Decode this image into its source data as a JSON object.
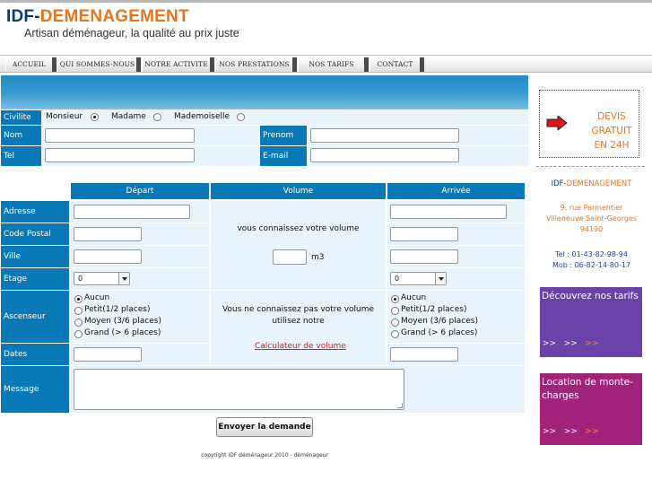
{
  "header": {
    "logo_part1": "IDF-",
    "logo_part2": "DEMENAGEMENT",
    "tagline": "Artisan déménageur, la qualité au prix juste"
  },
  "nav": [
    {
      "label": "ACCUEIL"
    },
    {
      "label": "QUI SOMMES-NOUS"
    },
    {
      "label": "NOTRE ACTIVITE"
    },
    {
      "label": "NOS PRESTATIONS"
    },
    {
      "label": "NOS TARIFS"
    },
    {
      "label": "CONTACT"
    }
  ],
  "form": {
    "civilite_label": "Civilite",
    "civilite_options": [
      {
        "label": "Monsieur",
        "selected": true
      },
      {
        "label": "Madame",
        "selected": false
      },
      {
        "label": "Mademoiselle",
        "selected": false
      }
    ],
    "nom_label": "Nom",
    "nom_value": "",
    "prenom_label": "Prenom",
    "prenom_value": "",
    "tel_label": "Tel",
    "tel_value": "",
    "email_label": "E-mail",
    "email_value": "",
    "col_depart": "Départ",
    "col_volume": "Volume",
    "col_arrivee": "Arrivée",
    "adresse_label": "Adresse",
    "cp_label": "Code Postal",
    "ville_label": "Ville",
    "etage_label": "Etage",
    "etage_depart_value": "0",
    "etage_arrivee_value": "0",
    "ascenseur_label": "Ascenseur",
    "ascenseur_depart": [
      {
        "label": "Aucun",
        "selected": true
      },
      {
        "label": "Petit(1/2 places)",
        "selected": false
      },
      {
        "label": "Moyen (3/6 places)",
        "selected": false
      },
      {
        "label": "Grand (> 6 places)",
        "selected": false
      }
    ],
    "ascenseur_arrivee": [
      {
        "label": "Aucun",
        "selected": true
      },
      {
        "label": "Petit(1/2 places)",
        "selected": false
      },
      {
        "label": "Moyen (3/6 places)",
        "selected": false
      },
      {
        "label": "Grand (> 6 places)",
        "selected": false
      }
    ],
    "dates_label": "Dates",
    "message_label": "Message",
    "message_value": "",
    "volume_known_text": "vous connaissez votre volume",
    "volume_value": "",
    "volume_unit": "m3",
    "volume_unknown_line1": "Vous ne connaissez pas votre volume",
    "volume_unknown_line2": "utilisez notre",
    "calc_link": "Calculateur de volume",
    "submit_label": "Envoyer la demande"
  },
  "footer": {
    "copyright": "copyright IDF déménageur 2010 - déménageur"
  },
  "sidebar": {
    "devis_line1": "DEVIS",
    "devis_line2": "GRATUIT",
    "devis_line3": "EN 24H",
    "company_part1": "IDF-",
    "company_part2": "DEMENAGEMENT",
    "address_line1": "9, rue Parmentier",
    "address_line2": "Villeneuve Saint-Georges",
    "address_line3": "94190",
    "tel": "Tel : 01-43-82-98-94",
    "mob": "Mob : 06-82-14-80-17",
    "promo1_text": "Découvrez nos tarifs",
    "promo2_text": "Location de monte-charges",
    "promo_arrows_1": ">>",
    "promo_arrows_2": ">>",
    "promo_arrows_3": ">>"
  },
  "colors": {
    "label_blue": "#0879b6",
    "cell_bg": "#e9f3fa",
    "brand_orange": "#e8741b",
    "brand_navy": "#0b3b6d",
    "promo_purple": "#6a42a8",
    "promo_magenta": "#a2237c",
    "link_red": "#d61b1b"
  }
}
